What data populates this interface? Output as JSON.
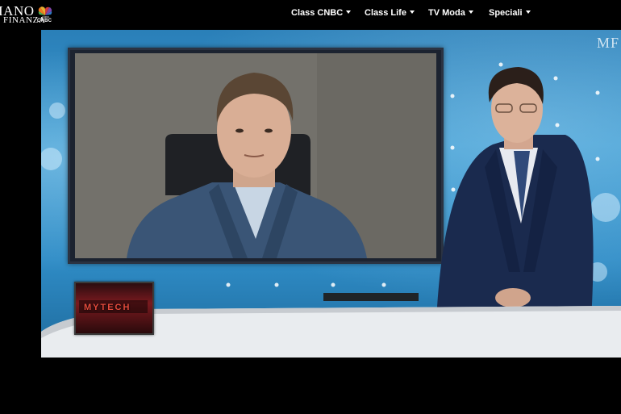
{
  "header": {
    "logo": {
      "line1": "IANO",
      "line2": "FINANZA",
      "class_label": "class",
      "cnbc_label": "CNBC"
    },
    "nav": [
      {
        "label": "Class CNBC"
      },
      {
        "label": "Class Life"
      },
      {
        "label": "TV Moda"
      },
      {
        "label": "Speciali"
      }
    ]
  },
  "video": {
    "corner_brand": "MF",
    "segment_tag": "MYTECH"
  },
  "colors": {
    "page_background": "#000000",
    "studio_blue": "#2f8cc6",
    "segment_red": "#e34a3c"
  }
}
